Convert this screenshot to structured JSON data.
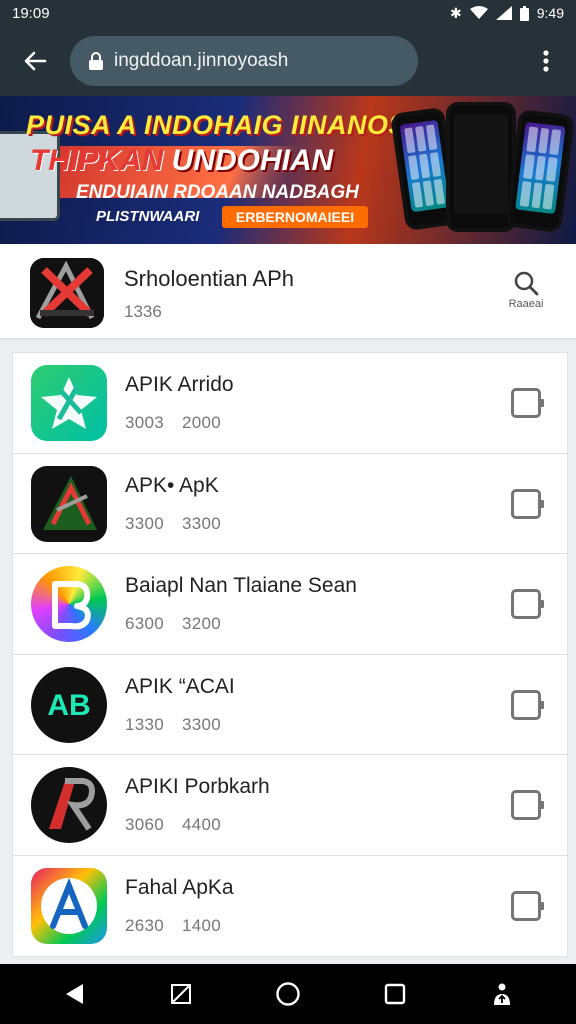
{
  "status_bar": {
    "time_left": "19:09",
    "time_right": "9:49"
  },
  "browser": {
    "url": "ingddoan.jinnoyoash"
  },
  "banner": {
    "line1": "PUISA A INDOHAIG IINANOSH",
    "line2_red": "THIPKAN",
    "line2_white": " UNDOHIAN",
    "line3": "ENDUIAIN RDOAAN NADBAGH",
    "line4": "PLISTNWAARI",
    "cta": "ERBERNOMAIEEI"
  },
  "app_header": {
    "title": "Srholoentian APh",
    "subtitle": "1336",
    "search_label": "Raaeai"
  },
  "apps": [
    {
      "name": "APIK Arrido",
      "stat1": "3003",
      "stat2": "2000",
      "icon": "green-star-icon"
    },
    {
      "name": "APK• ApK",
      "stat1": "3300",
      "stat2": "3300",
      "icon": "dark-triangle-icon"
    },
    {
      "name": "Baiapl Nan Tlaiane Sean",
      "stat1": "6300",
      "stat2": "3200",
      "icon": "gradient-b-icon"
    },
    {
      "name": "APIK “ACAI",
      "stat1": "1330",
      "stat2": "3300",
      "icon": "ab-circle-icon"
    },
    {
      "name": "APIKI Porbkarh",
      "stat1": "3060",
      "stat2": "4400",
      "icon": "red-r-icon"
    },
    {
      "name": "Fahal ApKa",
      "stat1": "2630",
      "stat2": "1400",
      "icon": "blue-a-icon"
    }
  ]
}
